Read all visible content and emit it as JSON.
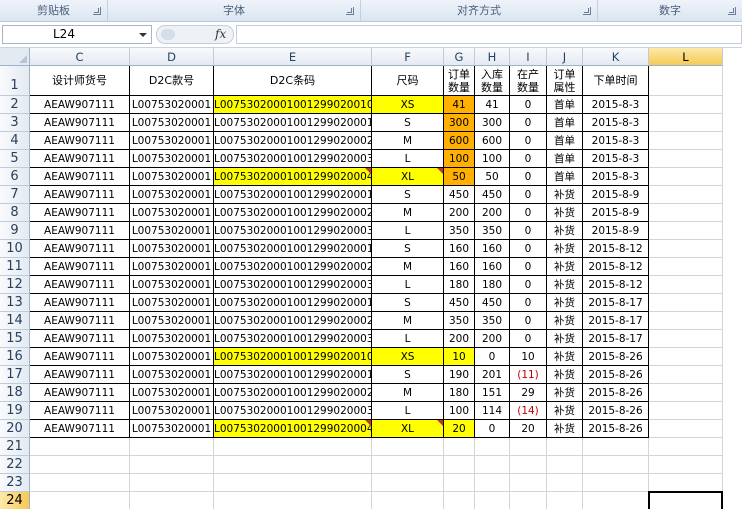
{
  "ribbon": {
    "groups": [
      "剪贴板",
      "字体",
      "对齐方式",
      "数字"
    ]
  },
  "formula_bar": {
    "name_box": "L24",
    "fx_label": "fx",
    "formula": ""
  },
  "sheet": {
    "columns": [
      "C",
      "D",
      "E",
      "F",
      "G",
      "H",
      "I",
      "J",
      "K",
      "L"
    ],
    "row_numbers": [
      "1",
      "2",
      "3",
      "4",
      "5",
      "6",
      "7",
      "8",
      "9",
      "10",
      "11",
      "12",
      "13",
      "14",
      "15",
      "16",
      "17",
      "18",
      "19",
      "20",
      "21",
      "22",
      "23",
      "24"
    ],
    "selected_cell": "L24",
    "header_row": [
      "设计师货号",
      "D2C款号",
      "D2C条码",
      "尺码",
      "订单数量",
      "入库数量",
      "在产数量",
      "订单属性",
      "下单时间"
    ],
    "rows": [
      [
        "AEAW907111",
        "L00753020001",
        "L00753020001001299020010",
        "XS",
        "41",
        "41",
        "0",
        "首单",
        "2015-8-3"
      ],
      [
        "AEAW907111",
        "L00753020001",
        "L00753020001001299020001",
        "S",
        "300",
        "300",
        "0",
        "首单",
        "2015-8-3"
      ],
      [
        "AEAW907111",
        "L00753020001",
        "L00753020001001299020002",
        "M",
        "600",
        "600",
        "0",
        "首单",
        "2015-8-3"
      ],
      [
        "AEAW907111",
        "L00753020001",
        "L00753020001001299020003",
        "L",
        "100",
        "100",
        "0",
        "首单",
        "2015-8-3"
      ],
      [
        "AEAW907111",
        "L00753020001",
        "L00753020001001299020004",
        "XL",
        "50",
        "50",
        "0",
        "首单",
        "2015-8-3"
      ],
      [
        "AEAW907111",
        "L00753020001",
        "L00753020001001299020001",
        "S",
        "450",
        "450",
        "0",
        "补货",
        "2015-8-9"
      ],
      [
        "AEAW907111",
        "L00753020001",
        "L00753020001001299020002",
        "M",
        "200",
        "200",
        "0",
        "补货",
        "2015-8-9"
      ],
      [
        "AEAW907111",
        "L00753020001",
        "L00753020001001299020003",
        "L",
        "350",
        "350",
        "0",
        "补货",
        "2015-8-9"
      ],
      [
        "AEAW907111",
        "L00753020001",
        "L00753020001001299020001",
        "S",
        "160",
        "160",
        "0",
        "补货",
        "2015-8-12"
      ],
      [
        "AEAW907111",
        "L00753020001",
        "L00753020001001299020002",
        "M",
        "160",
        "160",
        "0",
        "补货",
        "2015-8-12"
      ],
      [
        "AEAW907111",
        "L00753020001",
        "L00753020001001299020003",
        "L",
        "180",
        "180",
        "0",
        "补货",
        "2015-8-12"
      ],
      [
        "AEAW907111",
        "L00753020001",
        "L00753020001001299020001",
        "S",
        "450",
        "450",
        "0",
        "补货",
        "2015-8-17"
      ],
      [
        "AEAW907111",
        "L00753020001",
        "L00753020001001299020002",
        "M",
        "350",
        "350",
        "0",
        "补货",
        "2015-8-17"
      ],
      [
        "AEAW907111",
        "L00753020001",
        "L00753020001001299020003",
        "L",
        "200",
        "200",
        "0",
        "补货",
        "2015-8-17"
      ],
      [
        "AEAW907111",
        "L00753020001",
        "L00753020001001299020010",
        "XS",
        "10",
        "0",
        "10",
        "补货",
        "2015-8-26"
      ],
      [
        "AEAW907111",
        "L00753020001",
        "L00753020001001299020001",
        "S",
        "190",
        "201",
        "(11)",
        "补货",
        "2015-8-26"
      ],
      [
        "AEAW907111",
        "L00753020001",
        "L00753020001001299020002",
        "M",
        "180",
        "151",
        "29",
        "补货",
        "2015-8-26"
      ],
      [
        "AEAW907111",
        "L00753020001",
        "L00753020001001299020003",
        "L",
        "100",
        "114",
        "(14)",
        "补货",
        "2015-8-26"
      ],
      [
        "AEAW907111",
        "L00753020001",
        "L00753020001001299020004",
        "XL",
        "20",
        "0",
        "20",
        "补货",
        "2015-8-26"
      ]
    ],
    "yellow_rows": [
      0,
      4,
      14,
      18
    ],
    "orange_g_rows": [
      0,
      1,
      2,
      3,
      4
    ],
    "comment_rows": [
      4,
      18
    ],
    "red_i_rows": [
      15,
      17
    ],
    "colors": {
      "yellow_fill": "#ffff00",
      "orange_fill": "#ffb000",
      "negative_text": "#c00000",
      "selected_header": "#f6c954"
    }
  }
}
